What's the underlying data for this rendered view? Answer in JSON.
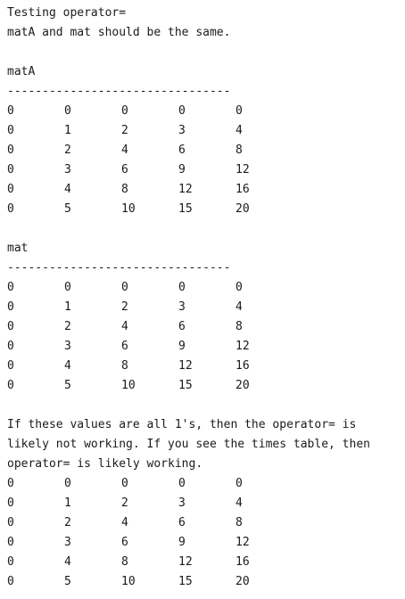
{
  "console": {
    "intro_line_1": "Testing operator=",
    "intro_line_2": "matA and mat should be the same.",
    "separator": "--------------------------------",
    "matA": {
      "label": "matA",
      "rows": [
        [
          "0",
          "0",
          "0",
          "0",
          "0"
        ],
        [
          "0",
          "1",
          "2",
          "3",
          "4"
        ],
        [
          "0",
          "2",
          "4",
          "6",
          "8"
        ],
        [
          "0",
          "3",
          "6",
          "9",
          "12"
        ],
        [
          "0",
          "4",
          "8",
          "12",
          "16"
        ],
        [
          "0",
          "5",
          "10",
          "15",
          "20"
        ]
      ]
    },
    "mat": {
      "label": "mat",
      "rows": [
        [
          "0",
          "0",
          "0",
          "0",
          "0"
        ],
        [
          "0",
          "1",
          "2",
          "3",
          "4"
        ],
        [
          "0",
          "2",
          "4",
          "6",
          "8"
        ],
        [
          "0",
          "3",
          "6",
          "9",
          "12"
        ],
        [
          "0",
          "4",
          "8",
          "12",
          "16"
        ],
        [
          "0",
          "5",
          "10",
          "15",
          "20"
        ]
      ]
    },
    "note_line_1": "If these values are all 1's, then the operator= is",
    "note_line_2": "likely not working. If you see the times table, then",
    "note_line_3": "operator= is likely working.",
    "final": {
      "rows": [
        [
          "0",
          "0",
          "0",
          "0",
          "0"
        ],
        [
          "0",
          "1",
          "2",
          "3",
          "4"
        ],
        [
          "0",
          "2",
          "4",
          "6",
          "8"
        ],
        [
          "0",
          "3",
          "6",
          "9",
          "12"
        ],
        [
          "0",
          "4",
          "8",
          "12",
          "16"
        ],
        [
          "0",
          "5",
          "10",
          "15",
          "20"
        ]
      ]
    }
  }
}
